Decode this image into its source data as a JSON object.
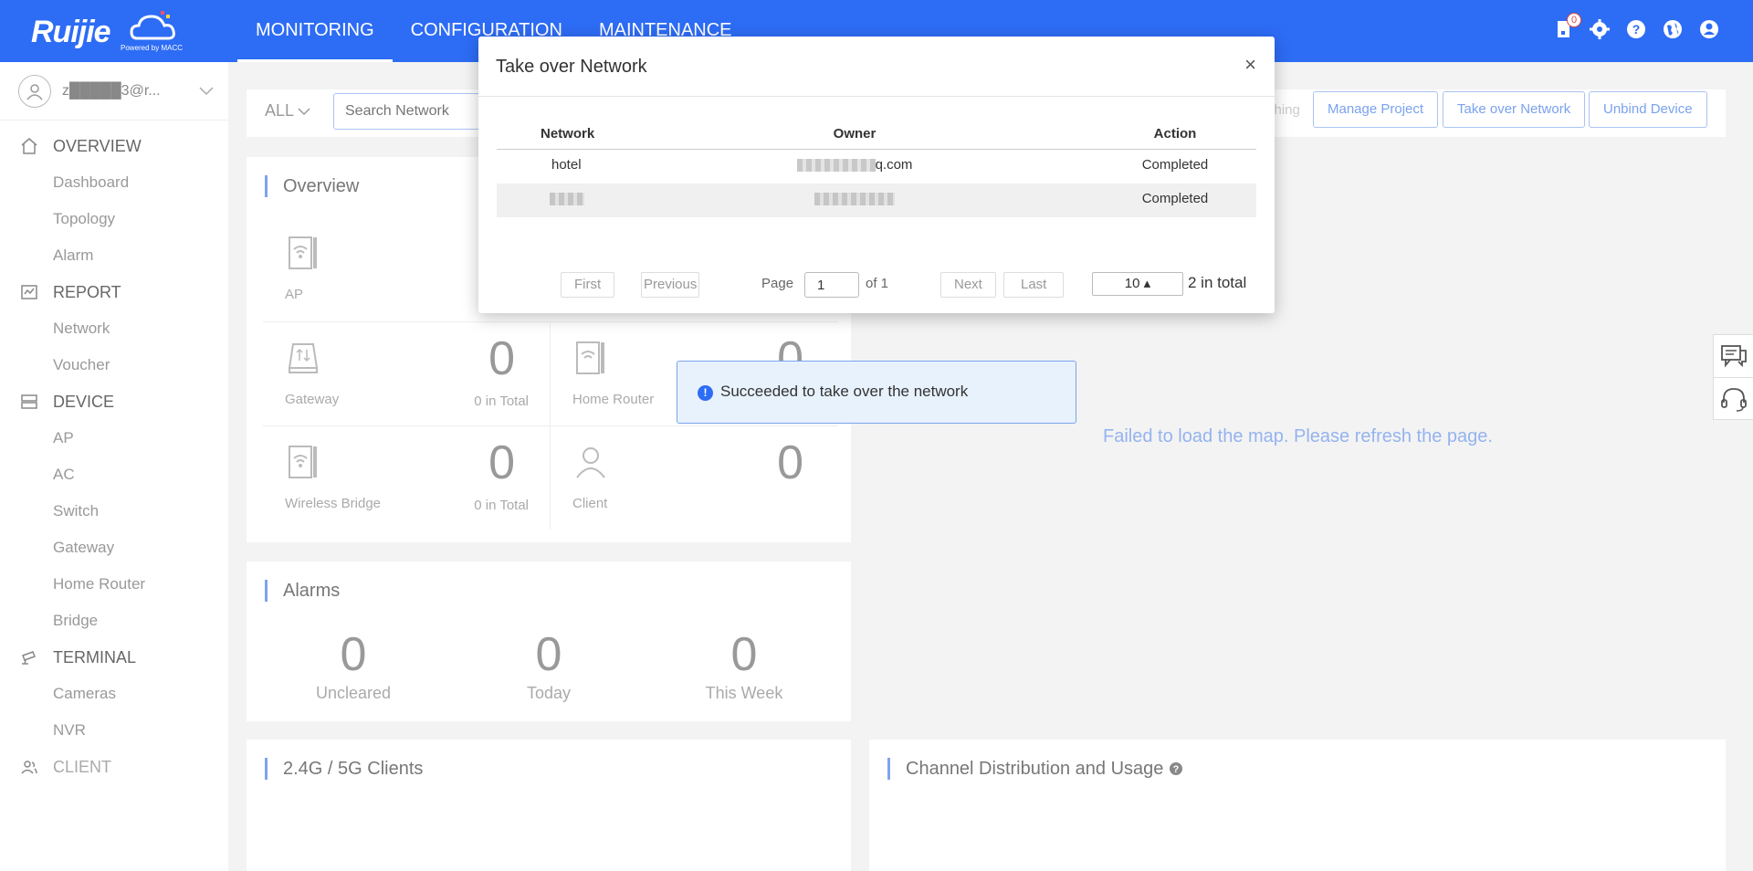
{
  "brand": {
    "logo_text": "Ruijie",
    "powered_by": "Powered by MACC"
  },
  "topnav": {
    "items": [
      "MONITORING",
      "CONFIGURATION",
      "MAINTENANCE"
    ]
  },
  "top_icons": {
    "notification_count": "0"
  },
  "sidebar": {
    "user": "z█████3@r...",
    "groups": [
      {
        "label": "OVERVIEW",
        "icon": "home-icon",
        "items": [
          "Dashboard",
          "Topology",
          "Alarm"
        ]
      },
      {
        "label": "REPORT",
        "icon": "report-icon",
        "items": [
          "Network",
          "Voucher"
        ]
      },
      {
        "label": "DEVICE",
        "icon": "device-icon",
        "items": [
          "AP",
          "AC",
          "Switch",
          "Gateway",
          "Home Router",
          "Bridge"
        ]
      },
      {
        "label": "TERMINAL",
        "icon": "camera-icon",
        "items": [
          "Cameras",
          "NVR"
        ]
      },
      {
        "label": "CLIENT",
        "icon": "users-icon",
        "items": []
      }
    ]
  },
  "filterbar": {
    "all": "ALL",
    "search_placeholder": "Search Network",
    "switching": "ching",
    "buttons": [
      "Manage Project",
      "Take over Network",
      "Unbind Device"
    ]
  },
  "overview": {
    "title": "Overview",
    "stats": [
      {
        "label": "AP",
        "value": "",
        "total": ""
      },
      {
        "label": "Gateway",
        "value": "0",
        "total": "0 in Total"
      },
      {
        "label": "Home Router",
        "value": "0",
        "total": ""
      },
      {
        "label": "Wireless Bridge",
        "value": "0",
        "total": "0 in Total"
      },
      {
        "label": "Client",
        "value": "0",
        "total": ""
      }
    ]
  },
  "alarms": {
    "title": "Alarms",
    "items": [
      {
        "value": "0",
        "label": "Uncleared"
      },
      {
        "value": "0",
        "label": "Today"
      },
      {
        "value": "0",
        "label": "This Week"
      }
    ]
  },
  "clients_card": {
    "title": "2.4G / 5G Clients"
  },
  "channel_card": {
    "title": "Channel Distribution and Usage"
  },
  "map": {
    "message": "Failed to load the map. Please refresh the page."
  },
  "modal": {
    "title": "Take over Network",
    "close": "×",
    "headers": {
      "network": "Network",
      "owner": "Owner",
      "action": "Action"
    },
    "rows": [
      {
        "network": "hotel",
        "owner_suffix": "q.com",
        "action": "Completed"
      },
      {
        "network": "",
        "owner_suffix": "",
        "action": "Completed"
      }
    ],
    "pager": {
      "first": "First",
      "previous": "Previous",
      "page_label": "Page",
      "page_value": "1",
      "of": "of 1",
      "next": "Next",
      "last": "Last",
      "page_size": "10 ▴",
      "total": "2 in total"
    }
  },
  "toast": {
    "message": "Succeeded to take over the network"
  }
}
